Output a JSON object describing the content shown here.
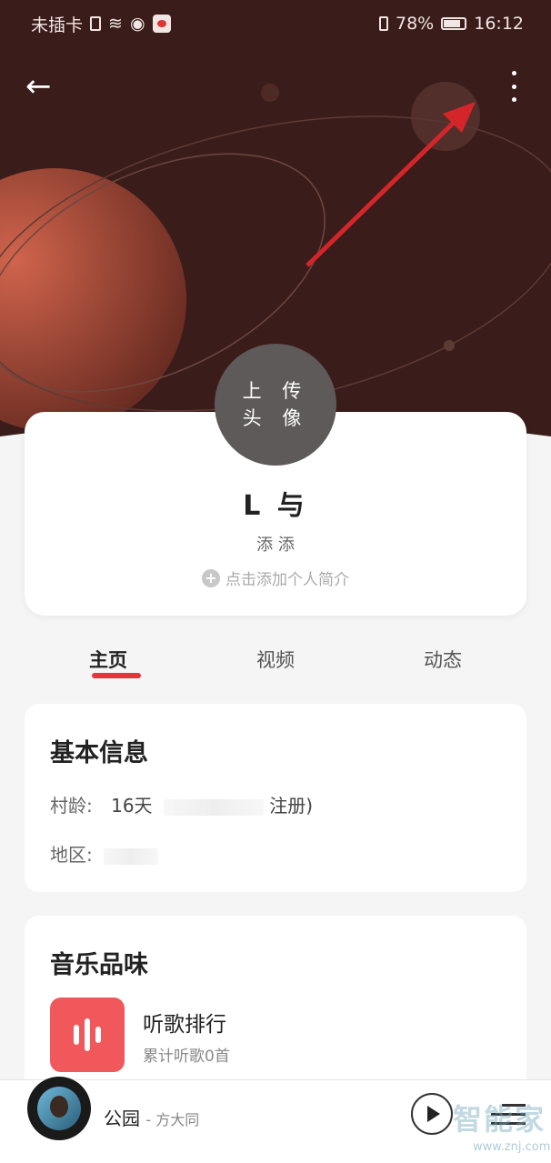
{
  "status_bar": {
    "carrier": "未插卡",
    "battery": "78%",
    "time": "16:12"
  },
  "profile": {
    "avatar_label_line1": "上 传",
    "avatar_label_line2": "头 像",
    "nickname": "L 与",
    "badges": "添 添",
    "add_intro": "点击添加个人简介"
  },
  "tabs": [
    {
      "label": "主页",
      "active": true
    },
    {
      "label": "视频",
      "active": false
    },
    {
      "label": "动态",
      "active": false
    }
  ],
  "basic_info": {
    "title": "基本信息",
    "age_label": "村龄:",
    "age_value": "16天",
    "age_suffix": "注册)",
    "region_label": "地区:"
  },
  "music_taste": {
    "title": "音乐品味",
    "rank_title": "听歌排行",
    "rank_sub": "累计听歌0首"
  },
  "player": {
    "song": "公园",
    "artist": "- 方大同"
  },
  "watermark": {
    "text": "智能家",
    "url": "www.znj.com"
  },
  "colors": {
    "accent": "#e2363c",
    "hero_bg": "#3a1d1a",
    "rank_icon": "#f0585c"
  }
}
